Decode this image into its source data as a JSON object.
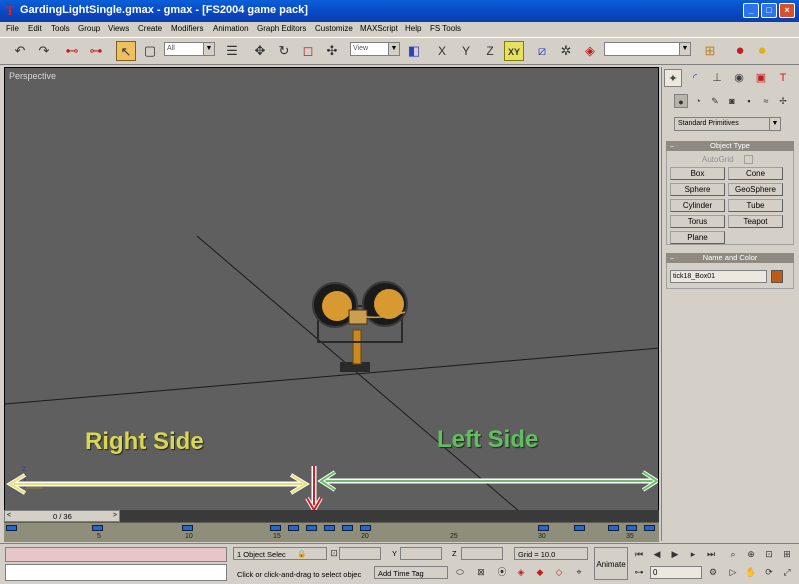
{
  "window": {
    "title": "GardingLightSingle.gmax - gmax - [FS2004 game pack]",
    "app_icon": "gmax-icon",
    "controls": [
      "minimize",
      "maximize",
      "close"
    ]
  },
  "menu": [
    "File",
    "Edit",
    "Tools",
    "Group",
    "Views",
    "Create",
    "Modifiers",
    "Animation",
    "Graph Editors",
    "Customize",
    "MAXScript",
    "Help",
    "FS Tools"
  ],
  "toolbar": {
    "selection_filter": "All",
    "reference_coord": "View",
    "named_selection": "",
    "axis_x": "X",
    "axis_y": "Y",
    "axis_z": "Z",
    "axis_xy": "XY"
  },
  "viewport": {
    "label": "Perspective",
    "right_side_label": "Right Side",
    "left_side_label": "Left Side",
    "axis_tripod": "z"
  },
  "command_panel": {
    "category": "Standard Primitives",
    "object_type": {
      "header": "Object Type",
      "autogrid": "AutoGrid",
      "buttons": [
        "Box",
        "Cone",
        "Sphere",
        "GeoSphere",
        "Cylinder",
        "Tube",
        "Torus",
        "Teapot",
        "Plane"
      ]
    },
    "name_and_color": {
      "header": "Name and Color",
      "name": "tick18_Box01",
      "color": "#c05a18"
    }
  },
  "timeline": {
    "position": "0 / 36",
    "tick_labels": [
      "5",
      "10",
      "15",
      "20",
      "25",
      "30",
      "35"
    ]
  },
  "status": {
    "selection": "1 Object Selec",
    "x_label": "X",
    "y_label": "Y",
    "z_label": "Z",
    "x_value": "",
    "y_value": "",
    "z_value": "",
    "grid": "Grid = 10.0",
    "prompt": "Click or click-and-drag to select objec",
    "add_time_tag": "Add Time Tag",
    "animate": "Animate",
    "frame": "0"
  }
}
